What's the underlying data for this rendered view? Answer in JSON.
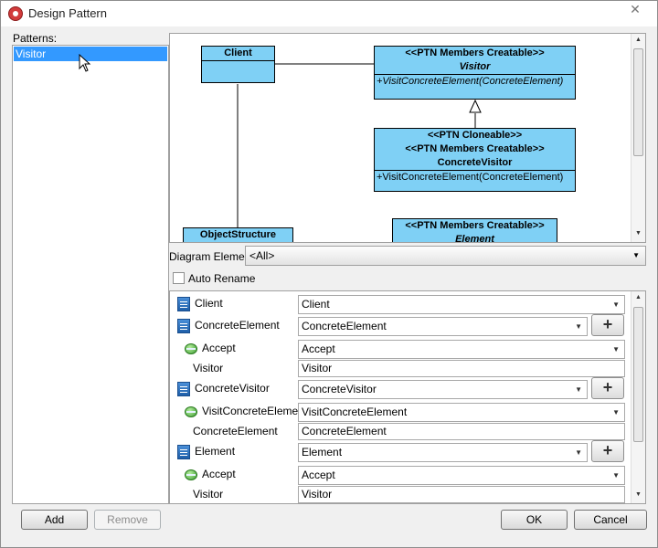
{
  "window": {
    "title": "Design Pattern",
    "close_glyph": "✕"
  },
  "patterns": {
    "label": "Patterns:",
    "items": [
      "Visitor"
    ]
  },
  "diagram": {
    "client": {
      "name": "Client"
    },
    "visitor": {
      "stereotype": "<<PTN Members Creatable>>",
      "name": "Visitor",
      "operation": "+VisitConcreteElement(ConcreteElement)"
    },
    "concrete_visitor": {
      "stereotype1": "<<PTN Cloneable>>",
      "stereotype2": "<<PTN Members Creatable>>",
      "name": "ConcreteVisitor",
      "operation": "+VisitConcreteElement(ConcreteElement)"
    },
    "object_structure": {
      "name": "ObjectStructure"
    },
    "element": {
      "stereotype": "<<PTN Members Creatable>>",
      "name": "Element"
    }
  },
  "diagram_element": {
    "label": "Diagram Element",
    "value": "<All>"
  },
  "auto_rename": {
    "label": "Auto Rename",
    "checked": false
  },
  "properties": [
    {
      "kind": "class",
      "label": "Client",
      "value": "Client"
    },
    {
      "kind": "class",
      "label": "ConcreteElement",
      "value": "ConcreteElement"
    },
    {
      "kind": "operation",
      "label": "Accept",
      "value": "Accept"
    },
    {
      "kind": "param",
      "label": "Visitor",
      "value": "Visitor"
    },
    {
      "kind": "class",
      "label": "ConcreteVisitor",
      "value": "ConcreteVisitor"
    },
    {
      "kind": "operation",
      "label": "VisitConcreteElement",
      "value": "VisitConcreteElement"
    },
    {
      "kind": "param",
      "label": "ConcreteElement",
      "value": "ConcreteElement"
    },
    {
      "kind": "class",
      "label": "Element",
      "value": "Element"
    },
    {
      "kind": "operation",
      "label": "Accept",
      "value": "Accept"
    },
    {
      "kind": "param",
      "label": "Visitor",
      "value": "Visitor"
    }
  ],
  "plus_glyph": "+",
  "buttons": {
    "add": "Add",
    "remove": "Remove",
    "ok": "OK",
    "cancel": "Cancel"
  }
}
